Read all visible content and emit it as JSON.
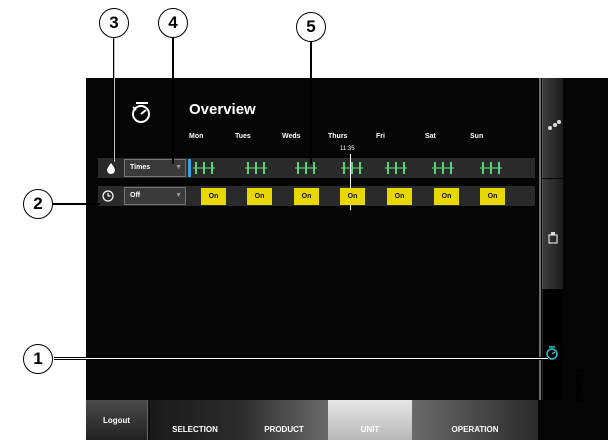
{
  "overview": {
    "title": "Overview"
  },
  "days": [
    "Mon",
    "Tues",
    "Weds",
    "Thurs",
    "Fri",
    "Sat",
    "Sun"
  ],
  "current_time": "11:35",
  "rows": {
    "times": {
      "label": "Times"
    },
    "timer": {
      "label": "Off",
      "cells": [
        "On",
        "On",
        "On",
        "On",
        "On",
        "On",
        "On"
      ]
    }
  },
  "tabs": {
    "logout": "Logout",
    "selection": "SELECTION",
    "product": "PRODUCT",
    "unit": "UNIT",
    "operation": "OPERATION"
  },
  "callouts": [
    "1",
    "2",
    "3",
    "4",
    "5"
  ],
  "figure_code": "000583",
  "colors": {
    "on": "#e8d800",
    "bars": "#5ad17a",
    "accent": "#3aa0e0"
  },
  "icons": [
    "overview-timer-icon",
    "water-drops-icon",
    "product-jar-icon",
    "timer-active-icon",
    "drop-icon",
    "clock-icon"
  ]
}
